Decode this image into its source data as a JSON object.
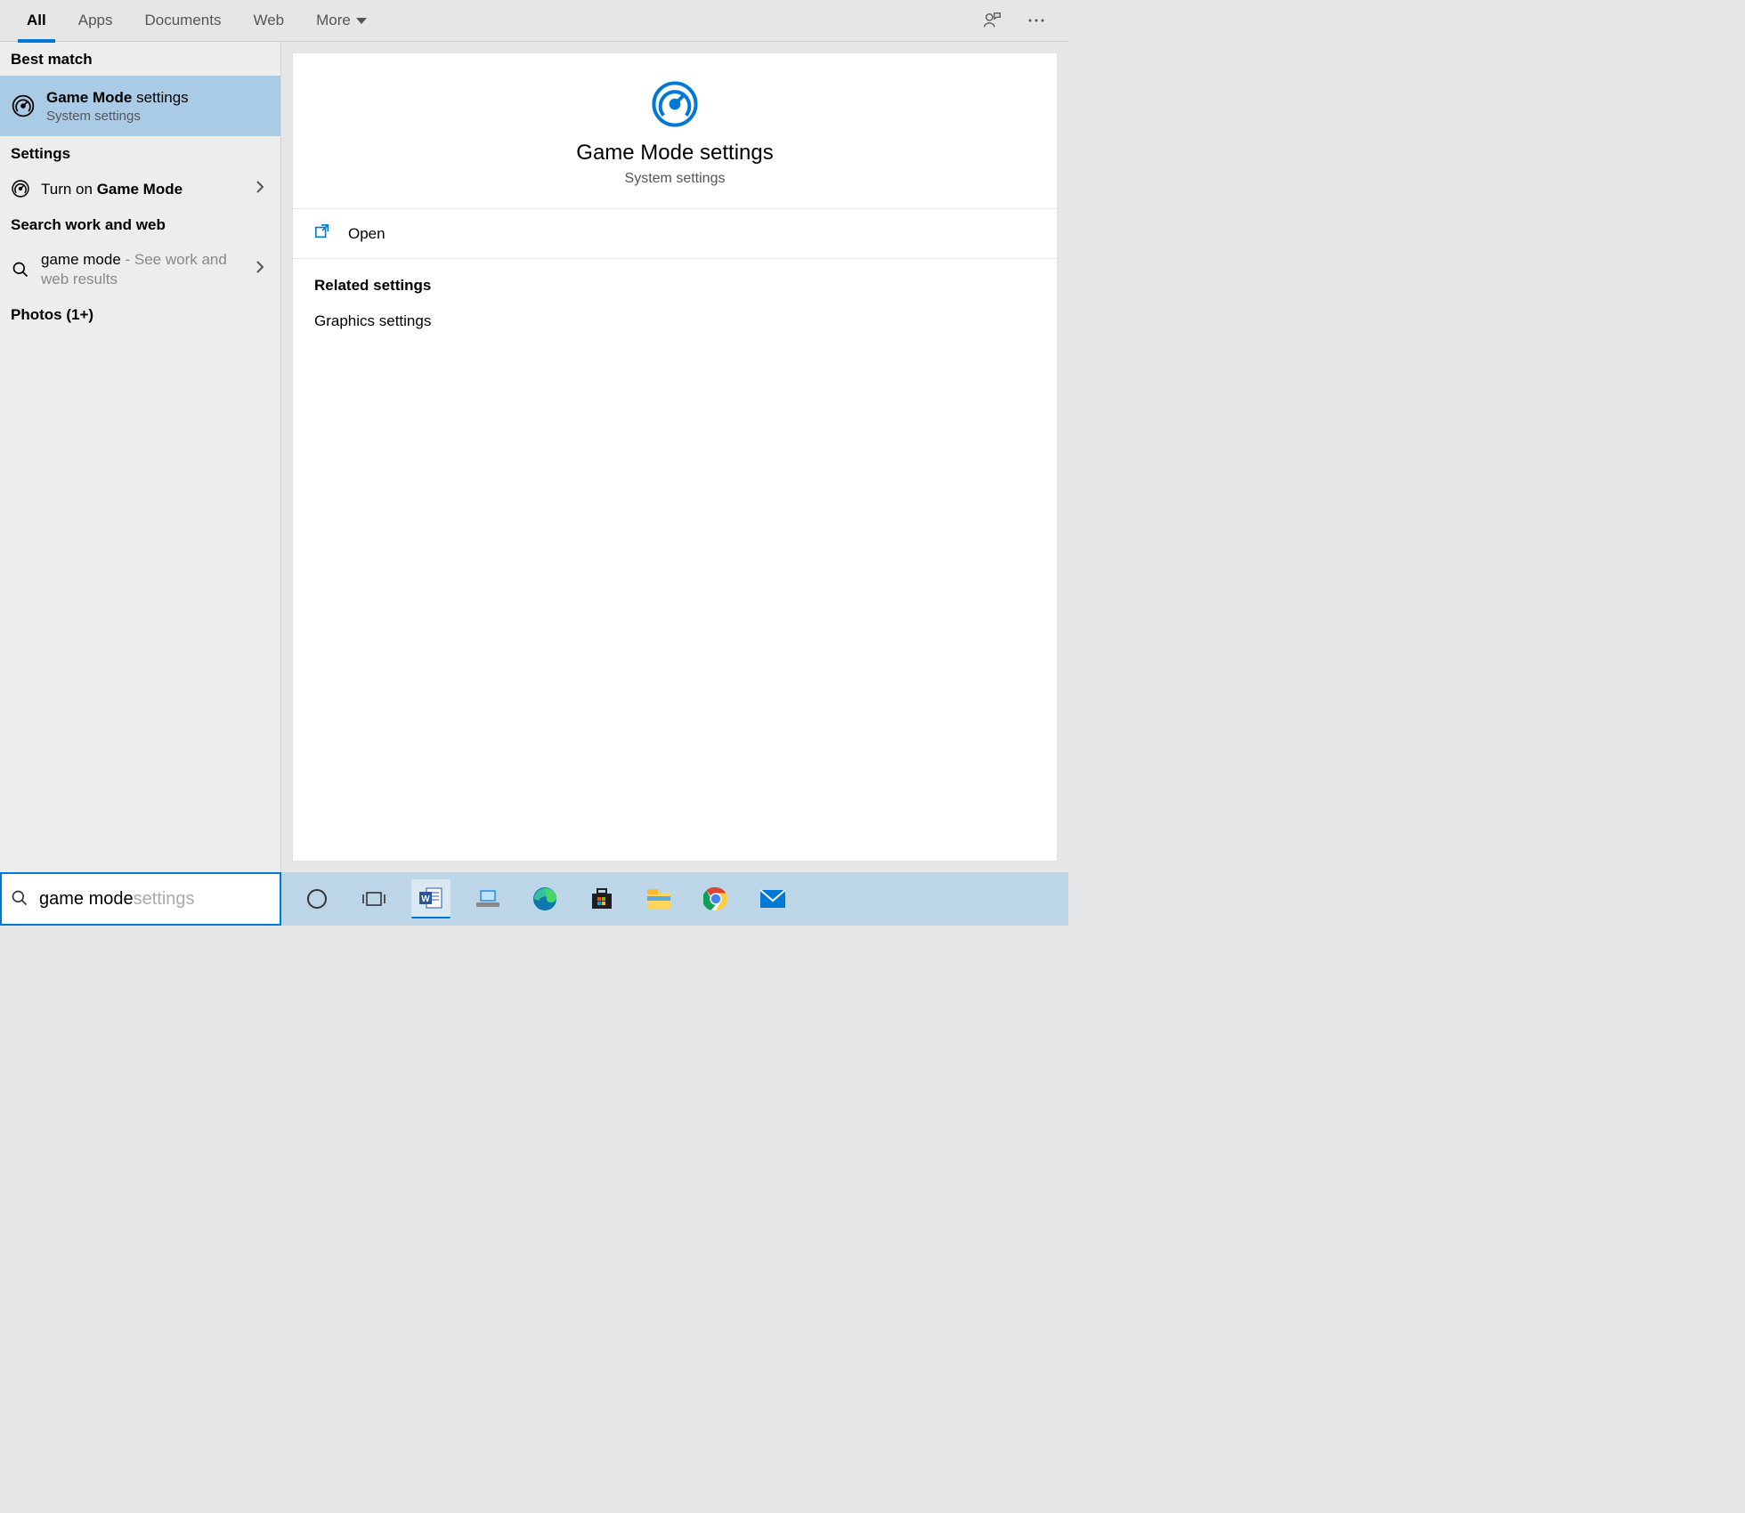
{
  "tabs": {
    "all": "All",
    "apps": "Apps",
    "documents": "Documents",
    "web": "Web",
    "more": "More"
  },
  "groups": {
    "best_match": "Best match",
    "settings": "Settings",
    "search_work_web": "Search work and web",
    "photos": "Photos (1+)"
  },
  "best_match_item": {
    "title_bold": "Game Mode",
    "title_rest": " settings",
    "subtitle": "System settings"
  },
  "settings_item": {
    "prefix": "Turn on ",
    "bold": "Game Mode"
  },
  "web_item": {
    "query": "game mode",
    "hint": " - See work and web results"
  },
  "preview": {
    "title": "Game Mode settings",
    "subtitle": "System settings",
    "open_label": "Open",
    "related_header": "Related settings",
    "related_link_1": "Graphics settings"
  },
  "search": {
    "typed": "game mode",
    "suggest": " settings"
  }
}
